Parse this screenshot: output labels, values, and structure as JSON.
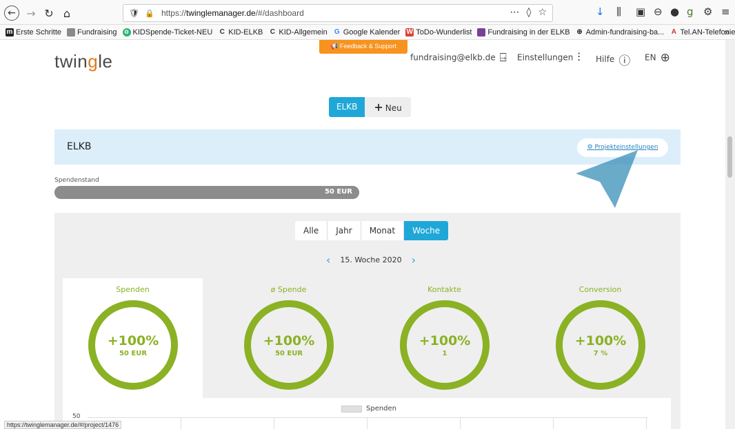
{
  "browser": {
    "url_prefix": "https://",
    "url_domain": "twinglemanager.de",
    "url_path": "/#/dashboard",
    "status_url": "https://twinglemanager.de/#/project/1476"
  },
  "bookmarks": [
    {
      "label": "Erste Schritte",
      "color": "#222222",
      "icon": "m"
    },
    {
      "label": "Fundraising",
      "color": "#8a8a8a",
      "icon": ""
    },
    {
      "label": "KIDSpende-Ticket-NEU",
      "color": "#2bb673",
      "icon": "o"
    },
    {
      "label": "KID-ELKB",
      "color": "#ffffff",
      "icon": "C"
    },
    {
      "label": "KID-Allgemein",
      "color": "#ffffff",
      "icon": "C"
    },
    {
      "label": "Google Kalender",
      "color": "#ffffff",
      "icon": "G"
    },
    {
      "label": "ToDo-Wunderlist",
      "color": "#db4437",
      "icon": "W"
    },
    {
      "label": "Fundraising in der ELKB",
      "color": "#7b3f98",
      "icon": ""
    },
    {
      "label": "Admin-fundraising-ba...",
      "color": "#ffffff",
      "icon": "⊕"
    },
    {
      "label": "Tel.AN-Telefonie",
      "color": "#ffffff",
      "icon": "A"
    }
  ],
  "header": {
    "logo_pre": "twin",
    "logo_g": "g",
    "logo_post": "le",
    "feedback": "Feedback & Support",
    "account": "fundraising@elkb.de",
    "settings": "Einstellungen",
    "help": "Hilfe",
    "lang": "EN"
  },
  "project_tabs": {
    "active": "ELKB",
    "new": "Neu"
  },
  "project": {
    "title": "ELKB",
    "settings_link": "Projekteinstellungen",
    "progress_label": "Spendenstand",
    "progress_value": "50 EUR",
    "progress_fraction": 1.0
  },
  "period_tabs": [
    "Alle",
    "Jahr",
    "Monat",
    "Woche"
  ],
  "week_label": "15. Woche 2020",
  "stats": [
    {
      "title": "Spenden",
      "pct": "+100%",
      "sub": "50 EUR"
    },
    {
      "title": "ø Spende",
      "pct": "+100%",
      "sub": "50 EUR"
    },
    {
      "title": "Kontakte",
      "pct": "+100%",
      "sub": "1"
    },
    {
      "title": "Conversion",
      "pct": "+100%",
      "sub": "7 %"
    }
  ],
  "chart": {
    "legend": "Spenden",
    "y_top": "50"
  },
  "colors": {
    "accent": "#1fa7d8",
    "green": "#8bb124",
    "orange": "#f7931e"
  }
}
